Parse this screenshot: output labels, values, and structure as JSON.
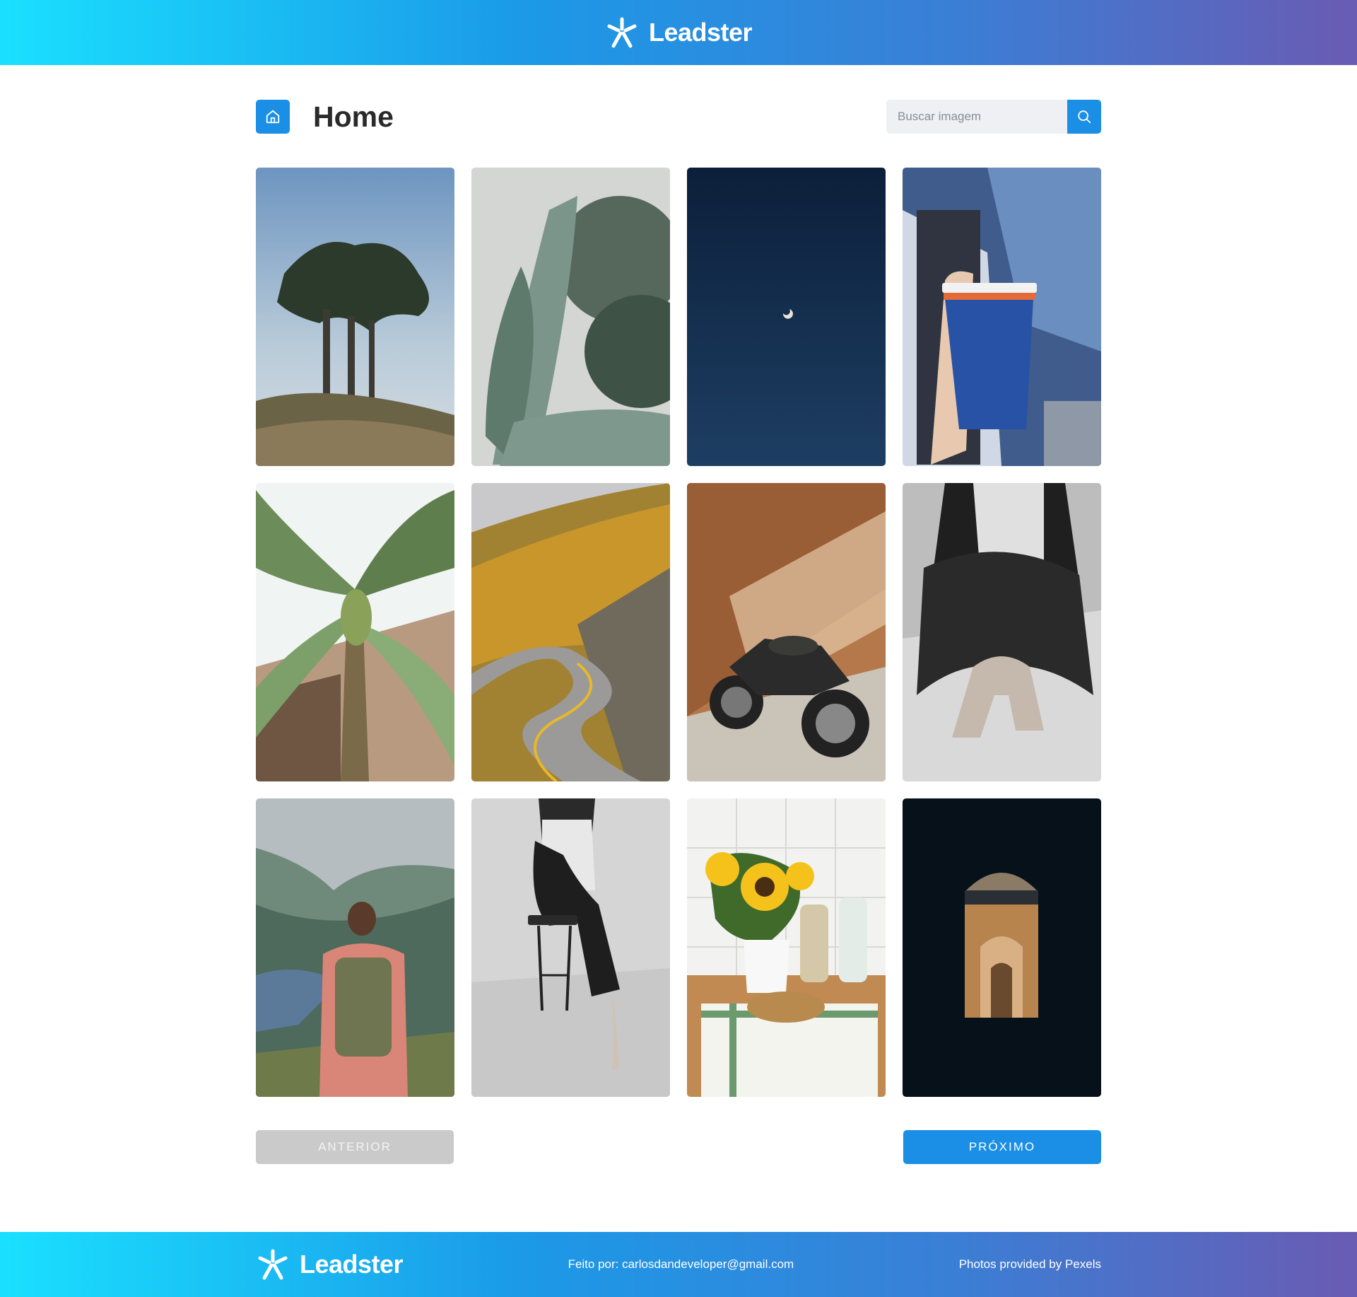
{
  "brand": {
    "name": "Leadster"
  },
  "header": {
    "title": "Home",
    "home_icon": "home-icon",
    "search": {
      "placeholder": "Buscar imagem",
      "value": "",
      "icon": "search-icon"
    }
  },
  "gallery": {
    "rows": 3,
    "columns": 4,
    "photos": [
      {
        "subject": "cypress-trees",
        "colors": [
          "#7ea2c6",
          "#2f3a2a"
        ]
      },
      {
        "subject": "banana-leaves",
        "colors": [
          "#c9d0cd",
          "#4f6a5e"
        ]
      },
      {
        "subject": "crescent-moon-sky",
        "colors": [
          "#0d2340",
          "#1a3a5e"
        ]
      },
      {
        "subject": "coffee-cup-building",
        "colors": [
          "#9fb6d6",
          "#1d3d86"
        ]
      },
      {
        "subject": "banana-tree",
        "colors": [
          "#eef3f2",
          "#5a7a4a"
        ]
      },
      {
        "subject": "winding-road-autumn",
        "colors": [
          "#c49a32",
          "#7f7a72"
        ]
      },
      {
        "subject": "motorcycle-brick-wall",
        "colors": [
          "#b87a4a",
          "#2a2a2a"
        ]
      },
      {
        "subject": "woman-sitting-bw",
        "colors": [
          "#e6e6e6",
          "#222222"
        ]
      },
      {
        "subject": "hiker-mountain-lake",
        "colors": [
          "#8a9ea0",
          "#d07a66"
        ]
      },
      {
        "subject": "woman-on-stool-bw",
        "colors": [
          "#d8d8d8",
          "#1a1a1a"
        ]
      },
      {
        "subject": "sunflowers-kitchen",
        "colors": [
          "#f4c21a",
          "#c08a4e"
        ]
      },
      {
        "subject": "dark-arch-window",
        "colors": [
          "#050f18",
          "#b8844e"
        ]
      }
    ]
  },
  "pagination": {
    "prev_label": "ANTERIOR",
    "next_label": "PRÓXIMO",
    "prev_enabled": false
  },
  "footer": {
    "credit": "Feito por: carlosdandeveloper@gmail.com",
    "photos_credit": "Photos provided by Pexels"
  },
  "colors": {
    "accent": "#1b8fe6",
    "gradient_start": "#1ae0ff",
    "gradient_end": "#6a5bb3",
    "disabled": "#cacaca"
  }
}
